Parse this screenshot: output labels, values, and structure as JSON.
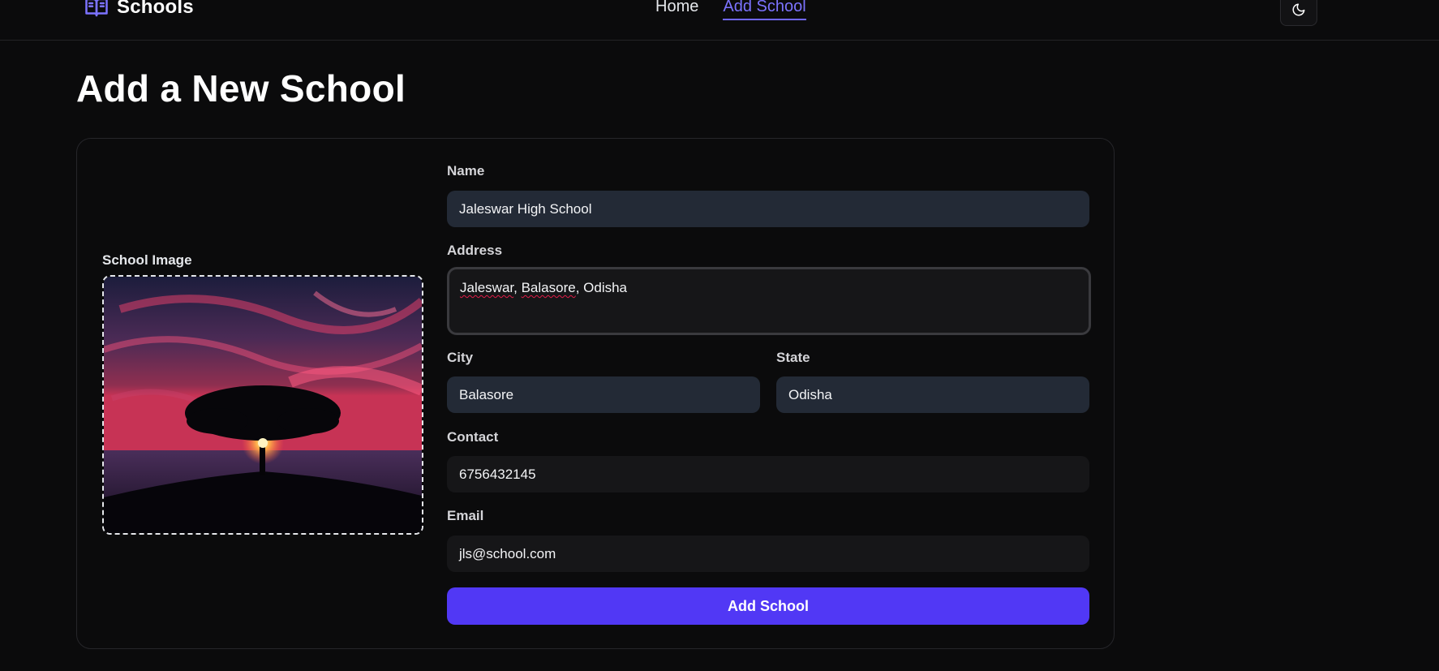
{
  "header": {
    "brand": "Schools",
    "nav": [
      {
        "label": "Home",
        "active": false
      },
      {
        "label": "Add School",
        "active": true
      }
    ],
    "theme_toggle_icon": "moon-icon"
  },
  "page": {
    "title": "Add a New School"
  },
  "form": {
    "image": {
      "label": "School Image",
      "preview": "tree-sunset-image"
    },
    "name": {
      "label": "Name",
      "value": "Jaleswar High School"
    },
    "address": {
      "label": "Address",
      "value_parts": [
        "Jaleswar",
        ", ",
        "Balasore",
        ", Odisha"
      ]
    },
    "city": {
      "label": "City",
      "value": "Balasore"
    },
    "state": {
      "label": "State",
      "value": "Odisha"
    },
    "contact": {
      "label": "Contact",
      "value": "6756432145"
    },
    "email": {
      "label": "Email",
      "value": "jls@school.com"
    },
    "submit_label": "Add School"
  },
  "colors": {
    "accent": "#5138f5",
    "nav_active": "#7c73ff",
    "background": "#0b0b0c",
    "filled_input": "#232a36",
    "plain_input": "#161618"
  }
}
